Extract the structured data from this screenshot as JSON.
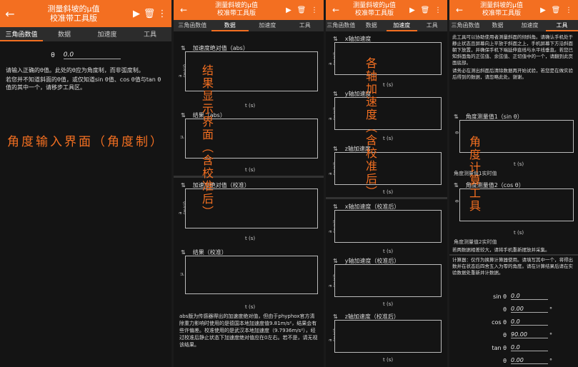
{
  "panel1": {
    "app": {
      "title_line1": "测量斜坡的μ值",
      "title_line2": "校准带工具版"
    },
    "tabs": [
      "三角函数值",
      "数据",
      "加速度",
      "工具"
    ],
    "theta_label": "θ",
    "theta_value": "0.0",
    "para1": "请输入正确的θ值。此处的θ应为角度制，而非弧度制。",
    "para2": "若您并不知道斜面的θ值，或仅知道sin θ值、cos θ值与tan θ值的其中一个，请移步工具区。",
    "annotation": "角度输入界面（角度制）"
  },
  "panel2": {
    "app": {
      "title_line1": "测量斜坡的μ值",
      "title_line2": "校准带工具版"
    },
    "tabs": [
      "三角函数值",
      "数据",
      "加速度",
      "工具"
    ],
    "sections": [
      {
        "title": "加速度绝对值（abs）",
        "ylabel": "a (m/s²)",
        "xlabel": "t (s)"
      },
      {
        "title": "结果（abs）",
        "ylabel": "μ",
        "xlabel": "t (s)"
      },
      {
        "title": "加速度绝对值（校准）",
        "ylabel": "a (m/s²)",
        "xlabel": "t (s)"
      },
      {
        "title": "结果（校准）",
        "ylabel": "μ",
        "xlabel": "t (s)"
      }
    ],
    "footer": "abs版为传感器得出的加速度绝对值，但由于phyphox官方清除重力影响时使用的是德国本地加速度值9.81m/s²，结果会有些许偏差。校准使用的是武汉本地加速度（9.7936m/s²），经过校准后静止状态下加速度绝对值应在0左右。若不是，请无视该结果。",
    "annotation": "结果显示界面（含校准后）"
  },
  "panel3": {
    "app": {
      "title_line1": "测量斜坡的μ值",
      "title_line2": "校准带工具版"
    },
    "tabs": [
      "三角函数值",
      "数据",
      "加速度",
      "工具"
    ],
    "sections": [
      {
        "title": "x轴加速度",
        "ylabel": "a (m/s²)",
        "xlabel": "t (s)"
      },
      {
        "title": "y轴加速度",
        "ylabel": "a (m/s²)",
        "xlabel": "t (s)"
      },
      {
        "title": "z轴加速度",
        "ylabel": "a (m/s²)",
        "xlabel": "t (s)"
      },
      {
        "title": "x轴加速度（校准后）",
        "ylabel": "a (m/s²)",
        "xlabel": "t (s)"
      },
      {
        "title": "y轴加速度（校准后）",
        "ylabel": "a (m/s²)",
        "xlabel": "t (s)"
      },
      {
        "title": "z轴加速度（校准后）",
        "ylabel": "a (m/s²)",
        "xlabel": "t (s)"
      }
    ],
    "annotation": "各轴加速度（含校准后）"
  },
  "panel4": {
    "app": {
      "title_line1": "测量斜坡的μ值",
      "title_line2": "校准带工具版"
    },
    "tabs": [
      "三角函数值",
      "数据",
      "加速度",
      "工具"
    ],
    "intro": "此工具可以协助使用者测量斜面的倾斜角。请确认手机处于静止状态且屏幕向上平放于斜面之上，手机屏幕下方沿斜面朝下放置，并确保手机下端延伸直线与水平线垂直。若您已知斜面角的正弦值、余弦值、正切值中的一个，请翻到此页面底部。",
    "note": "请务必在测出斜面后清除数据再开始试验，若您是在做实验后得到的数据，请忽略此处。谢谢。",
    "sections": [
      {
        "title": "角度测量值1（sin θ）",
        "ylabel": "θ",
        "xlabel": "t (s)",
        "result_label": "角度测量值1实时值"
      },
      {
        "title": "角度测量值2（cos θ）",
        "ylabel": "θ",
        "xlabel": "t (s)",
        "result_label": "角度测量值2实时值"
      }
    ],
    "note2": "若两数据相差较大，请将手机重新摆放并采集。",
    "calc_intro": "计算器：仅作为换算计算器使用。请填写其中一个，将得出数并在状态后四舍五入为零的角度。请在计算结果后请在实验数据处重新并计数据。",
    "calc": [
      {
        "label": "sin θ",
        "value": "0.0",
        "unit": ""
      },
      {
        "label": "θ",
        "value": "0.00",
        "unit": "°"
      },
      {
        "label": "cos θ",
        "value": "0.0",
        "unit": ""
      },
      {
        "label": "θ",
        "value": "90.00",
        "unit": "°"
      },
      {
        "label": "tan θ",
        "value": "0.0",
        "unit": ""
      },
      {
        "label": "θ",
        "value": "0.00",
        "unit": "°"
      }
    ],
    "annotation": "角度计算工具"
  },
  "icons": {
    "back": "arrow-left-icon",
    "play": "play-icon",
    "delete": "trash-icon",
    "menu": "more-vert-icon",
    "expand": "expand-collapse-icon"
  },
  "colors": {
    "accent": "#f36f21",
    "background": "#141414",
    "tabbar": "#2c2c2c"
  }
}
